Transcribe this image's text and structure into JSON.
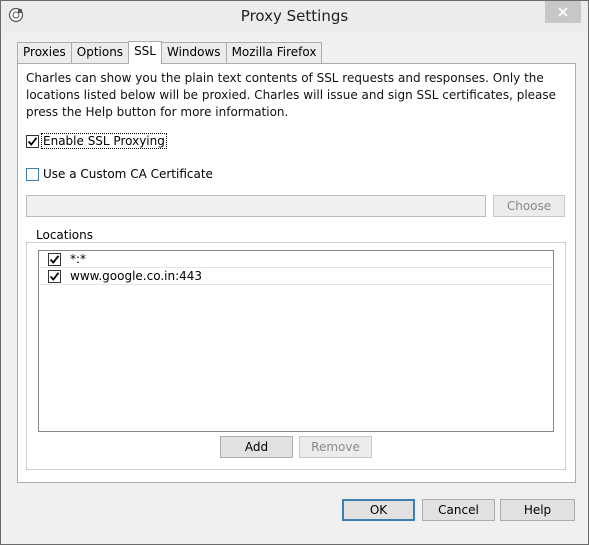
{
  "window": {
    "title": "Proxy Settings"
  },
  "tabs": [
    {
      "label": "Proxies",
      "active": false
    },
    {
      "label": "Options",
      "active": false
    },
    {
      "label": "SSL",
      "active": true
    },
    {
      "label": "Windows",
      "active": false
    },
    {
      "label": "Mozilla Firefox",
      "active": false
    }
  ],
  "ssl": {
    "description": "Charles can show you the plain text contents of SSL requests and responses. Only the locations listed below will be proxied. Charles will issue and sign SSL certificates, please press the Help button for more information.",
    "enable_ssl_label": "Enable SSL Proxying",
    "enable_ssl_checked": true,
    "custom_ca_label": "Use a Custom CA Certificate",
    "custom_ca_checked": false,
    "ca_path_value": "",
    "choose_label": "Choose"
  },
  "locations": {
    "title": "Locations",
    "items": [
      {
        "host": "*:*",
        "checked": true
      },
      {
        "host": "www.google.co.in:443",
        "checked": true
      }
    ],
    "add_label": "Add",
    "remove_label": "Remove"
  },
  "footer": {
    "ok_label": "OK",
    "cancel_label": "Cancel",
    "help_label": "Help"
  }
}
